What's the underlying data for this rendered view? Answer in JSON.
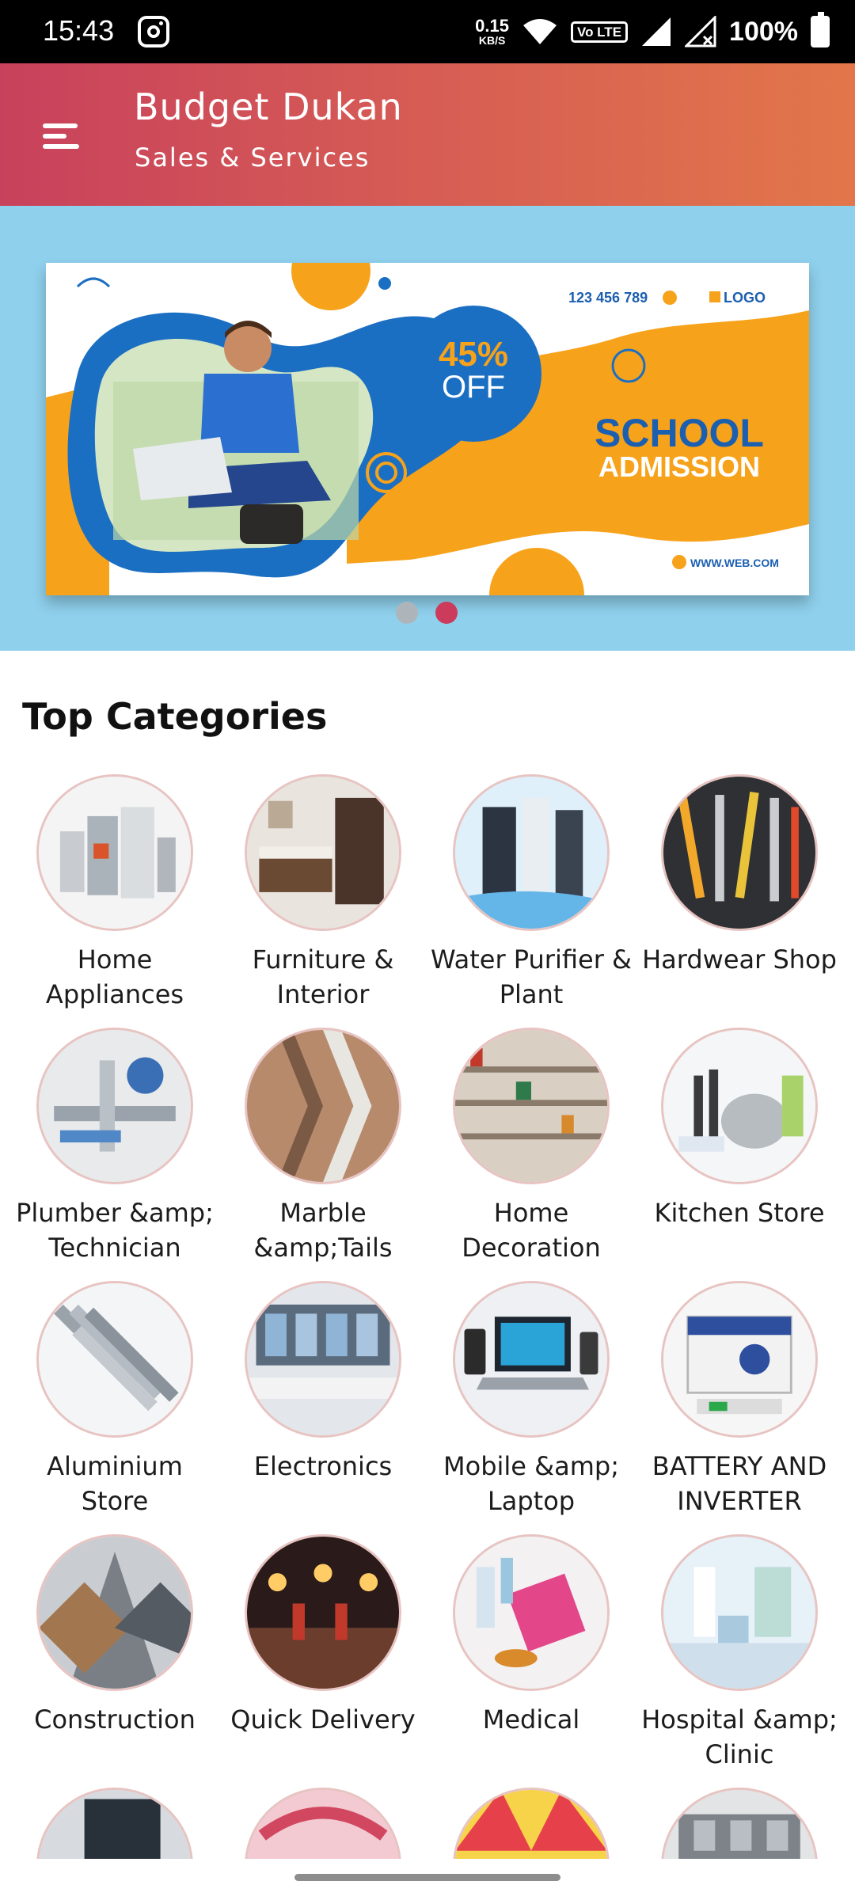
{
  "status_bar": {
    "time": "15:43",
    "net_speed_value": "0.15",
    "net_speed_unit": "KB/S",
    "lte_label": "Vo LTE",
    "battery": "100%"
  },
  "app_bar": {
    "title": "Budget Dukan",
    "subtitle": "Sales & Services",
    "menu_icon": "menu-icon"
  },
  "banner": {
    "phone": "123 456 789",
    "logo": "LOGO",
    "discount_value": "45%",
    "discount_label": "OFF",
    "headline_1": "SCHOOL",
    "headline_2": "ADMISSION",
    "website": "WWW.WEB.COM",
    "active_slide": 2,
    "slide_count": 2
  },
  "section": {
    "title": "Top Categories"
  },
  "categories": [
    {
      "label": "Home Appliances"
    },
    {
      "label": "Furniture & Interior"
    },
    {
      "label": "Water Purifier & Plant"
    },
    {
      "label": "Hardwear Shop"
    },
    {
      "label": "Plumber &amp; Technician"
    },
    {
      "label": "Marble &amp;Tails"
    },
    {
      "label": "Home Decoration"
    },
    {
      "label": "Kitchen Store"
    },
    {
      "label": "Aluminium Store"
    },
    {
      "label": "Electronics"
    },
    {
      "label": "Mobile &amp; Laptop"
    },
    {
      "label": "BATTERY AND INVERTER"
    },
    {
      "label": "Construction"
    },
    {
      "label": "Quick Delivery"
    },
    {
      "label": "Medical"
    },
    {
      "label": "Hospital &amp; Clinic"
    },
    {
      "label": ""
    },
    {
      "label": ""
    },
    {
      "label": ""
    },
    {
      "label": ""
    }
  ],
  "colors": {
    "app_bar_start": "#c8415c",
    "app_bar_end": "#e2764a",
    "banner_bg": "#8fd0ec",
    "dot_active": "#cc3b5b",
    "dot_inactive": "#aeb5ba"
  }
}
